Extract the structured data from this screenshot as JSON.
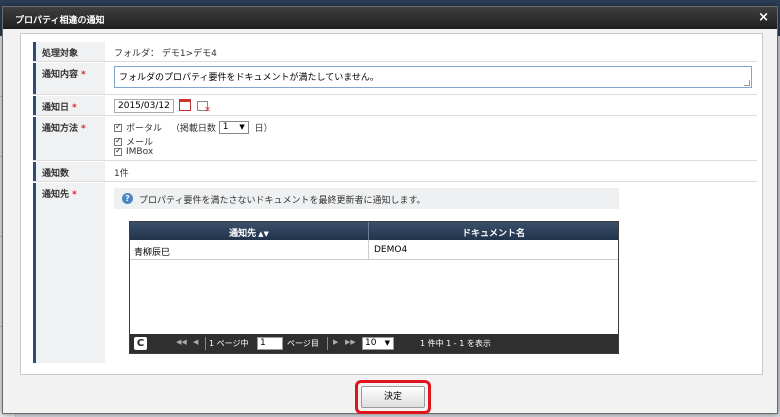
{
  "dialog": {
    "title": "プロパティ相違の通知",
    "close": "×"
  },
  "form": {
    "target": {
      "label": "処理対象",
      "value": "フォルダ： デモ1>デモ4"
    },
    "content": {
      "label": "通知内容",
      "value": "フォルダのプロパティ要件をドキュメントが満たしていません。"
    },
    "date": {
      "label": "通知日",
      "value": "2015/03/12"
    },
    "method": {
      "label": "通知方法",
      "portal": "ポータル",
      "days_prefix": "（掲載日数",
      "days_value": "1",
      "days_suffix": "日）",
      "mail": "メール",
      "imbox": "IMBox"
    },
    "count": {
      "label": "通知数",
      "value": "1件"
    },
    "recipients": {
      "label": "通知先",
      "info": "プロパティ要件を満たさないドキュメントを最終更新者に通知します。"
    },
    "required_mark": "*"
  },
  "grid": {
    "columns": [
      "通知先",
      "ドキュメント名"
    ],
    "sort_icon": "▲▼",
    "rows": [
      {
        "recipient": "青柳辰巳",
        "document": "DEMO4"
      }
    ]
  },
  "pager": {
    "first": "◀◀",
    "prev": "◀",
    "page_prefix": "1 ページ中",
    "page_value": "1",
    "page_suffix": "ページ目",
    "next": "▶",
    "last": "▶▶",
    "rows_per_page": "10",
    "summary": "1 件中 1 - 1 を表示",
    "refresh": "C"
  },
  "footer": {
    "ok_label": "決定"
  }
}
